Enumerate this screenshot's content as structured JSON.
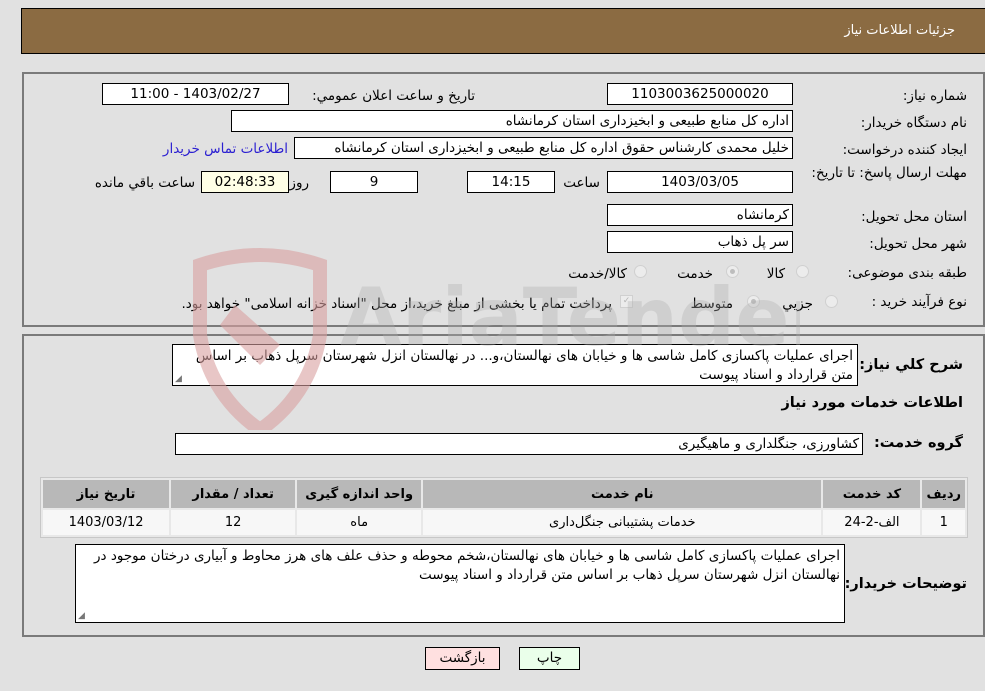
{
  "header": {
    "title": "جزئیات اطلاعات نیاز"
  },
  "details": {
    "need_number": {
      "label": "شماره نیاز:",
      "value": "1103003625000020"
    },
    "announce_datetime": {
      "label": "تاریخ و ساعت اعلان عمومي:",
      "value": "1403/02/27 - 11:00"
    },
    "buyer_org": {
      "label": "نام دستگاه خريدار:",
      "value": "اداره کل منابع طبیعی و ابخیزداری استان کرمانشاه"
    },
    "requester": {
      "label": "ایجاد کننده درخواست:",
      "value": "خلیل محمدی کارشناس حقوق اداره کل منابع طبیعی و ابخیزداری استان کرمانشاه",
      "contact_link": "اطلاعات تماس خريدار"
    },
    "deadline": {
      "label": "مهلت ارسال پاسخ: تا تاریخ:",
      "date": "1403/03/05",
      "time_label": "ساعت",
      "time": "14:15",
      "days": "9",
      "days_label": "روز و",
      "remaining": "02:48:33",
      "remaining_label": "ساعت باقي مانده"
    },
    "delivery_province": {
      "label": "استان محل تحویل:",
      "value": "کرمانشاه"
    },
    "delivery_city": {
      "label": "شهر محل تحویل:",
      "value": "سر پل ذهاب"
    },
    "category": {
      "label": "طبقه بندی موضوعی:",
      "options": [
        {
          "label": "کالا",
          "checked": false
        },
        {
          "label": "خدمت",
          "checked": true
        },
        {
          "label": "کالا/خدمت",
          "checked": false
        }
      ]
    },
    "purchase_type": {
      "label": "نوع فرآیند خرید :",
      "options": [
        {
          "label": "جزيي",
          "checked": false
        },
        {
          "label": "متوسط",
          "checked": true
        }
      ],
      "treasury_note": "پرداخت تمام یا بخشی از مبلغ خرید،از محل \"اسناد خزانه اسلامی\" خواهد بود.",
      "treasury_checked": true
    }
  },
  "services": {
    "general_desc_label": "شرح کلي نياز:",
    "general_desc": "اجرای عملیات پاکسازی کامل شاسی ها و خیابان های نهالستان،و... در نهالستان انزل شهرستان سرپل ذهاب بر اساس متن قرارداد و اسناد پیوست",
    "section_title": "اطلاعات خدمات مورد نیاز",
    "service_group_label": "گروه خدمت:",
    "service_group": "کشاورزی، جنگلداری و ماهیگیری",
    "table": {
      "headers": [
        "ردیف",
        "کد خدمت",
        "نام خدمت",
        "واحد اندازه گیری",
        "تعداد / مقدار",
        "تاریخ نیاز"
      ],
      "rows": [
        [
          "1",
          "الف-2-24",
          "خدمات پشتیبانی جنگل‌داری",
          "ماه",
          "12",
          "1403/03/12"
        ]
      ]
    },
    "buyer_notes_label": "توضیحات خریدار:",
    "buyer_notes": "اجرای عملیات پاکسازی کامل شاسی ها و خیابان های نهالستان،شخم محوطه و حذف علف های هرز محاوط و آبیاری درختان موجود در نهالستان انزل شهرستان سرپل ذهاب بر اساس متن قرارداد و اسناد پیوست"
  },
  "buttons": {
    "print": "چاپ",
    "back": "بازگشت"
  },
  "colors": {
    "header_bg": "#8b6b42",
    "print_bg": "#eaffea",
    "back_bg": "#ffe0e0",
    "link": "#2b1fd1"
  },
  "watermark": {
    "text": "AriaTender.neT"
  }
}
